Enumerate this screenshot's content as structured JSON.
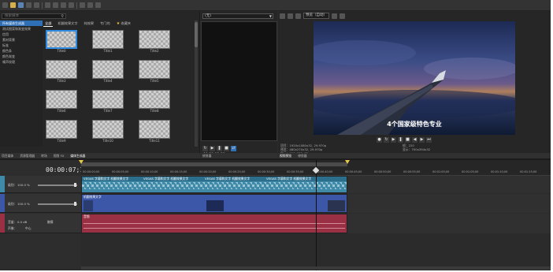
{
  "left": {
    "search_placeholder": "搜索媒体",
    "tree": [
      "所有媒体生成器",
      "测试图案和渐变效果",
      "信用",
      "素材背景",
      "标准",
      "颜色条",
      "颜色渐变",
      "噪声纹理"
    ],
    "tabs": [
      "全部",
      "机翻效果文字",
      "纯效果",
      "专门的"
    ],
    "favorites_tab": "收藏夹",
    "thumbs": [
      "Title0",
      "Title1",
      "Title2",
      "Title3",
      "Title4",
      "Title5",
      "Title6",
      "Title7",
      "Title8",
      "Title9",
      "Title10",
      "Title11"
    ],
    "desc_line1": "VEGAS 字幕和文字：GPU、32 位浮点、GPU 加速、分组 VEGAS、版本 1.0",
    "desc_line2": "说明：文字和标题生成器系列。",
    "bottom_tabs": [
      "项目媒体",
      "资源管理器",
      "转场",
      "视频 FX",
      "媒体生成器"
    ]
  },
  "middle": {
    "selector": "(无)",
    "time": "00:00:00;00",
    "tabs": [
      "修剪器"
    ]
  },
  "preview": {
    "selector": "预览（自动）",
    "subtitle": "4个国家级特色专业",
    "info_project": "项目：1920x1080x32, 29.970p",
    "info_preview": "预览：480x270x32, 29.970p",
    "info_display": "显示：590x332x32",
    "info_frame_label": "帧：",
    "info_frame": "220",
    "info_display2_label": "显示：",
    "info_display2": "700x394x32",
    "tabs": [
      "视频预览",
      "修剪器"
    ]
  },
  "timeline": {
    "timecode": "00:00:07;10",
    "ruler_labels": [
      "00:00:00;00",
      "00:00:05;00",
      "00:00:10;00",
      "00:00:15;00",
      "00:00:20;00",
      "00:00:25;00",
      "00:00:30;00",
      "00:00:35;00",
      "00:00:40;00",
      "00:00:45;00",
      "00:00:50;00",
      "00:00:55;00",
      "00:01:00;00",
      "00:01:05;00",
      "00:01:10;00",
      "00:01:15;00"
    ],
    "track1": {
      "level_label": "级别：",
      "level": "100.0 %"
    },
    "track2": {
      "level_label": "级别：",
      "level": "100.0 %"
    },
    "track3": {
      "vol_label": "音量：",
      "vol": "0.0 dB",
      "pan_label": "声像：",
      "pan": "中心",
      "mode": "触摸"
    },
    "title_clip_label": "VEGAS 字幕和文字 机翻效果文字",
    "video_clip_label": "机翻效果文字",
    "audio_clip_label": "音频"
  },
  "colors": {
    "selection": "#2f6fb5",
    "title_track": "#3f8aa8",
    "video_track": "#3d57a8",
    "audio_track": "#9a3044"
  }
}
